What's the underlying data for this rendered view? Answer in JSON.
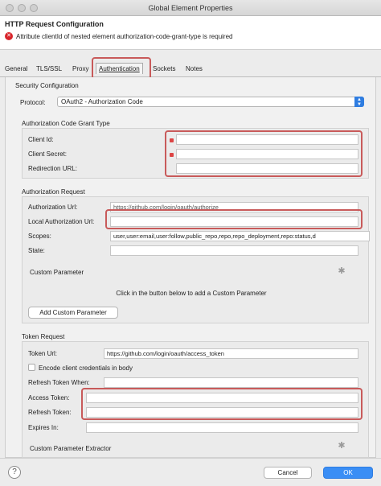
{
  "window": {
    "title": "Global Element Properties"
  },
  "header": {
    "title": "HTTP Request Configuration",
    "error": "Attribute clientId of nested element authorization-code-grant-type is required"
  },
  "tabs": [
    "General",
    "TLS/SSL",
    "Proxy",
    "Authentication",
    "Sockets",
    "Notes"
  ],
  "security": {
    "title": "Security Configuration",
    "protocol_label": "Protocol:",
    "protocol_value": "OAuth2 - Authorization Code"
  },
  "grant": {
    "title": "Authorization Code Grant Type",
    "client_id": "Client Id:",
    "client_secret": "Client Secret:",
    "redirection_url": "Redirection URL:"
  },
  "auth_request": {
    "title": "Authorization Request",
    "auth_url_label": "Authorization Url:",
    "auth_url_value": "https://github.com/login/oauth/authorize",
    "local_auth_label": "Local Authorization Url:",
    "scopes_label": "Scopes:",
    "scopes_value": "user,user:email,user:follow,public_repo,repo,repo_deployment,repo:status,d",
    "state_label": "State:",
    "custom_param": "Custom Parameter",
    "hint": "Click in the button below to add a Custom Parameter",
    "add_button": "Add Custom Parameter"
  },
  "token_request": {
    "title": "Token Request",
    "token_url_label": "Token Url:",
    "token_url_value": "https://github.com/login/oauth/access_token",
    "encode_label": "Encode client credentials in body",
    "refresh_when": "Refresh Token When:",
    "access_token": "Access Token:",
    "refresh_token": "Refresh Token:",
    "expires_in": "Expires In:",
    "extractor": "Custom Parameter Extractor"
  },
  "footer": {
    "help": "?",
    "cancel": "Cancel",
    "ok": "OK"
  },
  "colors": {
    "accent": "#3a8ef5",
    "error": "#d8262c",
    "highlight": "#c85a5a"
  }
}
